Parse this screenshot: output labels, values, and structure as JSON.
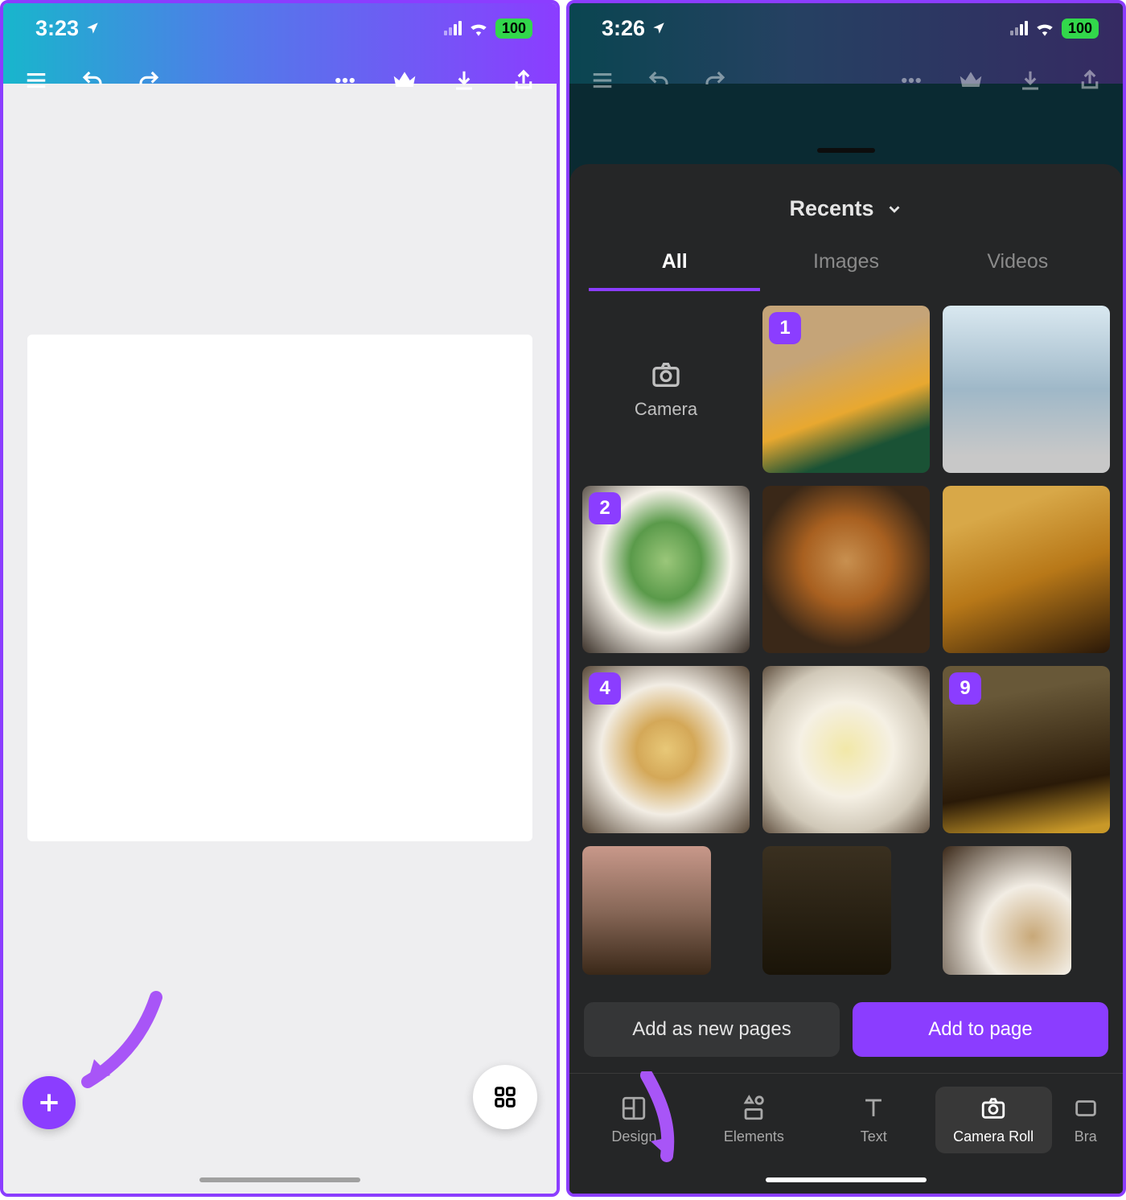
{
  "left": {
    "status": {
      "time": "3:23",
      "battery": "100"
    }
  },
  "right": {
    "status": {
      "time": "3:26",
      "battery": "100"
    },
    "sheet": {
      "title": "Recents",
      "tabs": {
        "all": "All",
        "images": "Images",
        "videos": "Videos"
      },
      "camera_label": "Camera",
      "badges": {
        "b1": "1",
        "b2": "2",
        "b4": "4",
        "b9": "9"
      },
      "actions": {
        "add_pages": "Add as new pages",
        "add_to_page": "Add to page"
      }
    },
    "bottomnav": {
      "design": "Design",
      "elements": "Elements",
      "text": "Text",
      "camera_roll": "Camera Roll",
      "brand": "Bra"
    }
  }
}
